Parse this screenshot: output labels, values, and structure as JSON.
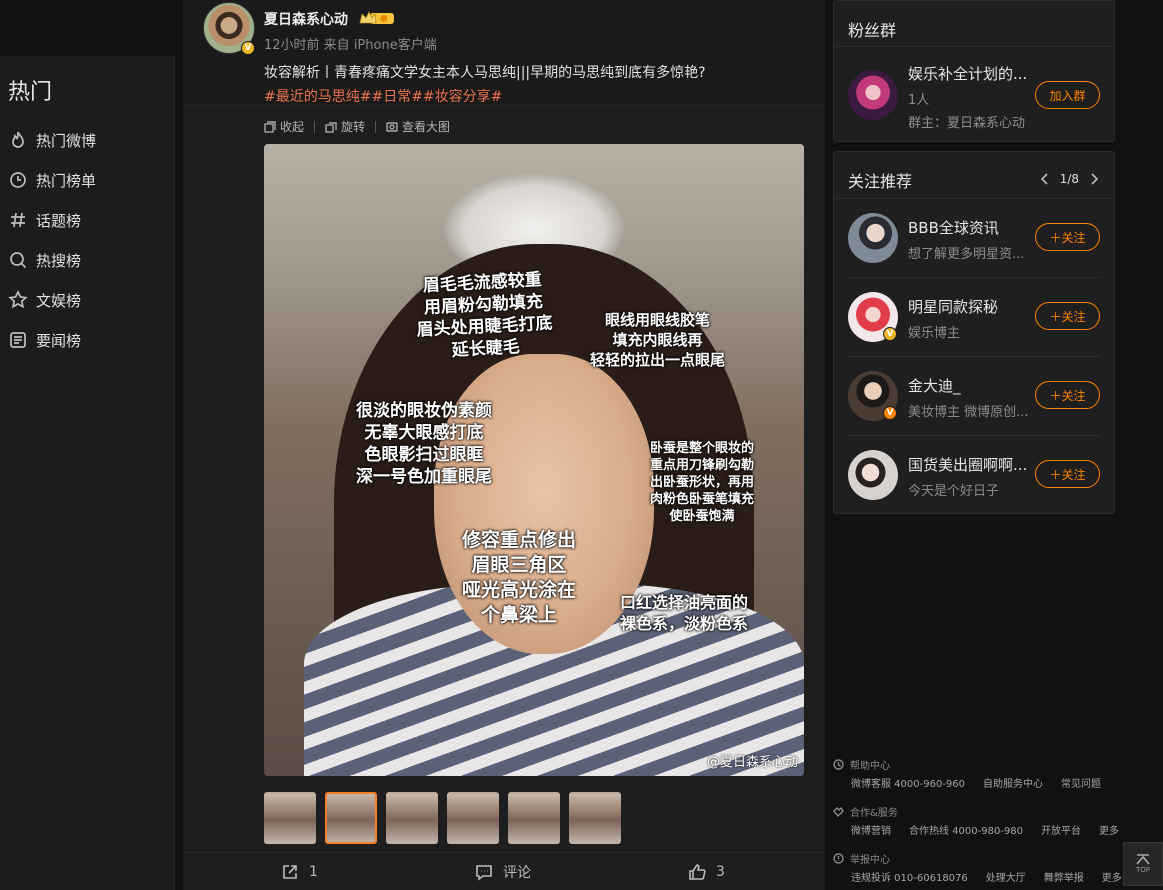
{
  "left_nav": {
    "title": "热门",
    "items": [
      {
        "label": "热门微博",
        "icon": "fire-icon"
      },
      {
        "label": "热门榜单",
        "icon": "clock-rank-icon"
      },
      {
        "label": "话题榜",
        "icon": "hashtag-icon"
      },
      {
        "label": "热搜榜",
        "icon": "search-rank-icon"
      },
      {
        "label": "文娱榜",
        "icon": "star-icon"
      },
      {
        "label": "要闻榜",
        "icon": "news-icon"
      }
    ]
  },
  "post": {
    "author": "夏日森系心动",
    "meta": "12小时前  来自 iPhone客户端",
    "text": "妆容解析丨青春疼痛文学女主本人马思纯|||早期的马思纯到底有多惊艳?",
    "tags": "#最近的马思纯##日常##妆容分享#",
    "tools": {
      "collapse": "收起",
      "rotate": "旋转",
      "view_large": "查看大图"
    },
    "image_annotations": {
      "brows": "眉毛毛流感较重\n用眉粉勾勒填充\n眉头处用睫毛打底\n延长睫毛",
      "eyeliner": "眼线用眼线胶笔\n填充内眼线再\n轻轻的拉出一点眼尾",
      "eyeshadow": "很淡的眼妆伪素颜\n无辜大眼感打底\n色眼影扫过眼眶\n深一号色加重眼尾",
      "aegyo": "卧蚕是整个眼妆的\n重点用刀锋刷勾勒\n出卧蚕形状，再用\n肉粉色卧蚕笔填充\n使卧蚕饱满",
      "contour": "修容重点修出\n眉眼三角区\n哑光高光涂在\n个鼻梁上",
      "lipstick": "口红选择油亮面的\n裸色系，淡粉色系"
    },
    "watermark": "@夏日森系心动",
    "thumbnails": 6,
    "active_thumbnail": 1,
    "actions": {
      "repost": "1",
      "comment": "评论",
      "like": "3"
    }
  },
  "fan_group": {
    "title": "粉丝群",
    "group_name": "娱乐补全计划的...",
    "members": "1人",
    "owner": "群主：夏日森系心动",
    "join_label": "加入群"
  },
  "recommend": {
    "title": "关注推荐",
    "page": "1/8",
    "follow_label": "关注",
    "users": [
      {
        "name": "BBB全球资讯",
        "desc": "想了解更多明星资..."
      },
      {
        "name": "明星同款探秘",
        "desc": "娱乐博主"
      },
      {
        "name": "金大迪_",
        "desc": "美妆博主 微博原创..."
      },
      {
        "name": "国货美出圈啊啊...",
        "desc": "今天是个好日子"
      }
    ]
  },
  "footer": {
    "help": {
      "title": "帮助中心",
      "links": [
        "微博客服 4000-960-960",
        "自助服务中心",
        "常见问题"
      ]
    },
    "coop": {
      "title": "合作&服务",
      "links": [
        "微博营销",
        "合作热线 4000-980-980",
        "开放平台",
        "更多"
      ]
    },
    "report": {
      "title": "举报中心",
      "links": [
        "违规投诉 010-60618076",
        "处理大厅",
        "舞弊举报",
        "更多"
      ]
    }
  },
  "top_label": "TOP",
  "colors": {
    "accent": "#ff8200",
    "tag": "#eb7350",
    "badge": "#f0b526"
  }
}
